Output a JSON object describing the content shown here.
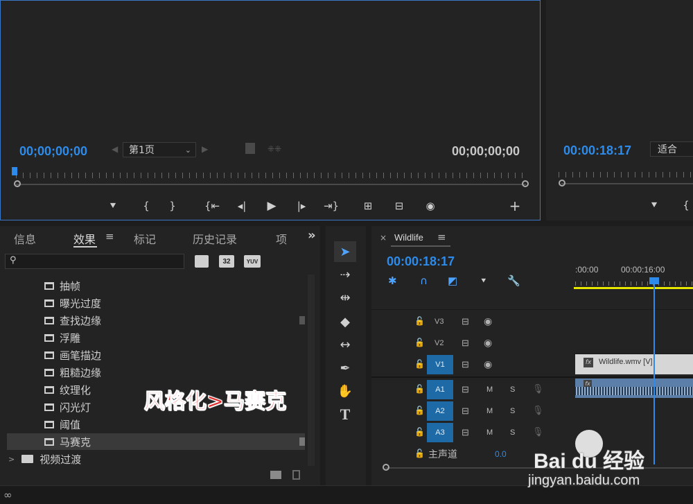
{
  "source_monitor": {
    "timecode_left": "00;00;00;00",
    "page_select": "第1页",
    "timecode_right": "00;00;00;00"
  },
  "program_monitor": {
    "timecode": "00:00:18:17",
    "fit_select": "适合"
  },
  "effects_panel": {
    "tabs": [
      "信息",
      "效果",
      "标记",
      "历史记录",
      "项"
    ],
    "more": "»",
    "preset_icons": [
      "32",
      "YUV"
    ],
    "items": [
      "抽帧",
      "曝光过度",
      "查找边缘",
      "浮雕",
      "画笔描边",
      "粗糙边缘",
      "纹理化",
      "闪光灯",
      "阈值",
      "马赛克"
    ],
    "folder": "视频过渡"
  },
  "annotation": "风格化>马赛克",
  "timeline": {
    "sequence_name": "Wildlife",
    "close": "×",
    "timecode": "00:00:18:17",
    "ruler_labels": [
      ":00:00",
      "00:00:16:00"
    ],
    "video_tracks": [
      "V3",
      "V2",
      "V1"
    ],
    "audio_tracks": [
      "A1",
      "A2",
      "A3"
    ],
    "mute": "M",
    "solo": "S",
    "master_label": "主声道",
    "master_value": "0.0",
    "clip_name": "Wildlife.wmv [V]",
    "fx_badge": "fx"
  },
  "watermark": {
    "brand": "Bai du 经验",
    "url": "jingyan.baidu.com"
  },
  "colors": {
    "accent": "#2d8ceb",
    "track_select": "#1e6aa6",
    "annotation": "#e03030",
    "work_area": "#e6e600"
  }
}
